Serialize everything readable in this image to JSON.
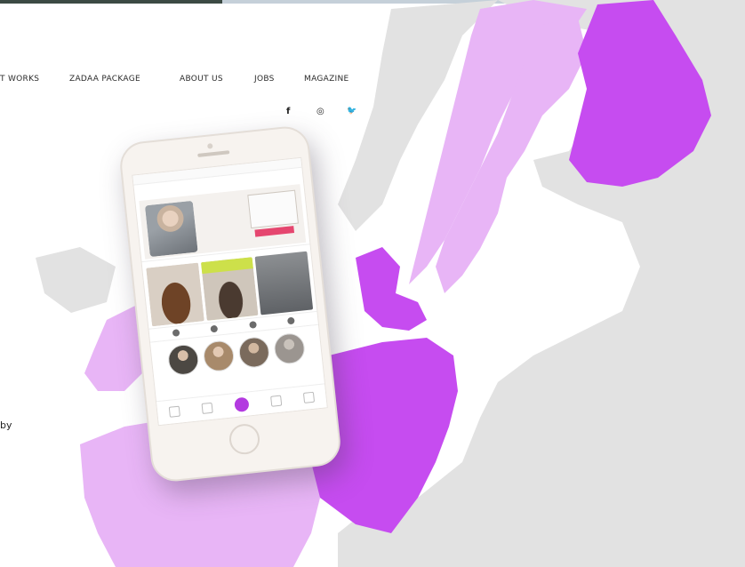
{
  "nav": {
    "items": [
      "T WORKS",
      "ZADAA PACKAGE",
      "ABOUT US",
      "JOBS",
      "MAGAZINE"
    ]
  },
  "social": {
    "facebook": "f",
    "instagram": "◎",
    "twitter": "🐦"
  },
  "side_text": "by",
  "colors": {
    "country_dark": "#c64cf0",
    "country_light": "#e8b5f6",
    "land_grey": "#e2e2e2",
    "water": "#ffffff",
    "accent": "#b33ae0"
  },
  "map": {
    "highlighted_countries_dark": [
      "Finland",
      "Denmark",
      "Germany"
    ],
    "highlighted_countries_light": [
      "Sweden",
      "Norway",
      "France",
      "United Kingdom"
    ]
  },
  "phone": {
    "icons": [
      "filter-icon",
      "heart-icon",
      "zadaa-tab-icon",
      "bag-icon",
      "profile-icon"
    ]
  }
}
